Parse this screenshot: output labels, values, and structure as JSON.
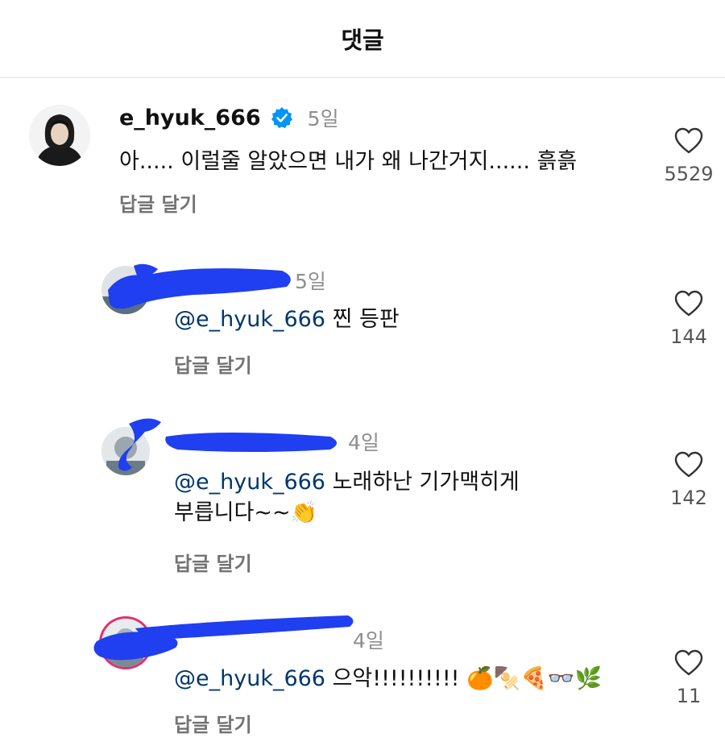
{
  "header": {
    "title": "댓글"
  },
  "comments": [
    {
      "username": "e_hyuk_666",
      "verified": true,
      "time": "5일",
      "text": "아..... 이럴줄 알았으면 내가 왜 나간거지...... 흙흙",
      "reply_label": "답글 달기",
      "likes": "5529"
    },
    {
      "time": "5일",
      "mention": "@e_hyuk_666",
      "text": " 찐 등판",
      "reply_label": "답글 달기",
      "likes": "144"
    },
    {
      "time": "4일",
      "mention": "@e_hyuk_666",
      "text_line1": " 노래하난 기가맥히게",
      "text_line2": "부릅니다~~👏",
      "reply_label": "답글 달기",
      "likes": "142"
    },
    {
      "time": "4일",
      "mention": "@e_hyuk_666",
      "text": " 으악!!!!!!!!!! 🍊🍢🍕👓🌿",
      "reply_label": "답글 달기",
      "likes": "11"
    }
  ],
  "icons": {
    "verified": "verified-badge-icon",
    "like": "heart-outline-icon"
  },
  "colors": {
    "mention": "#00376b",
    "verified": "#0095f6",
    "redaction": "#1f3ff0"
  }
}
